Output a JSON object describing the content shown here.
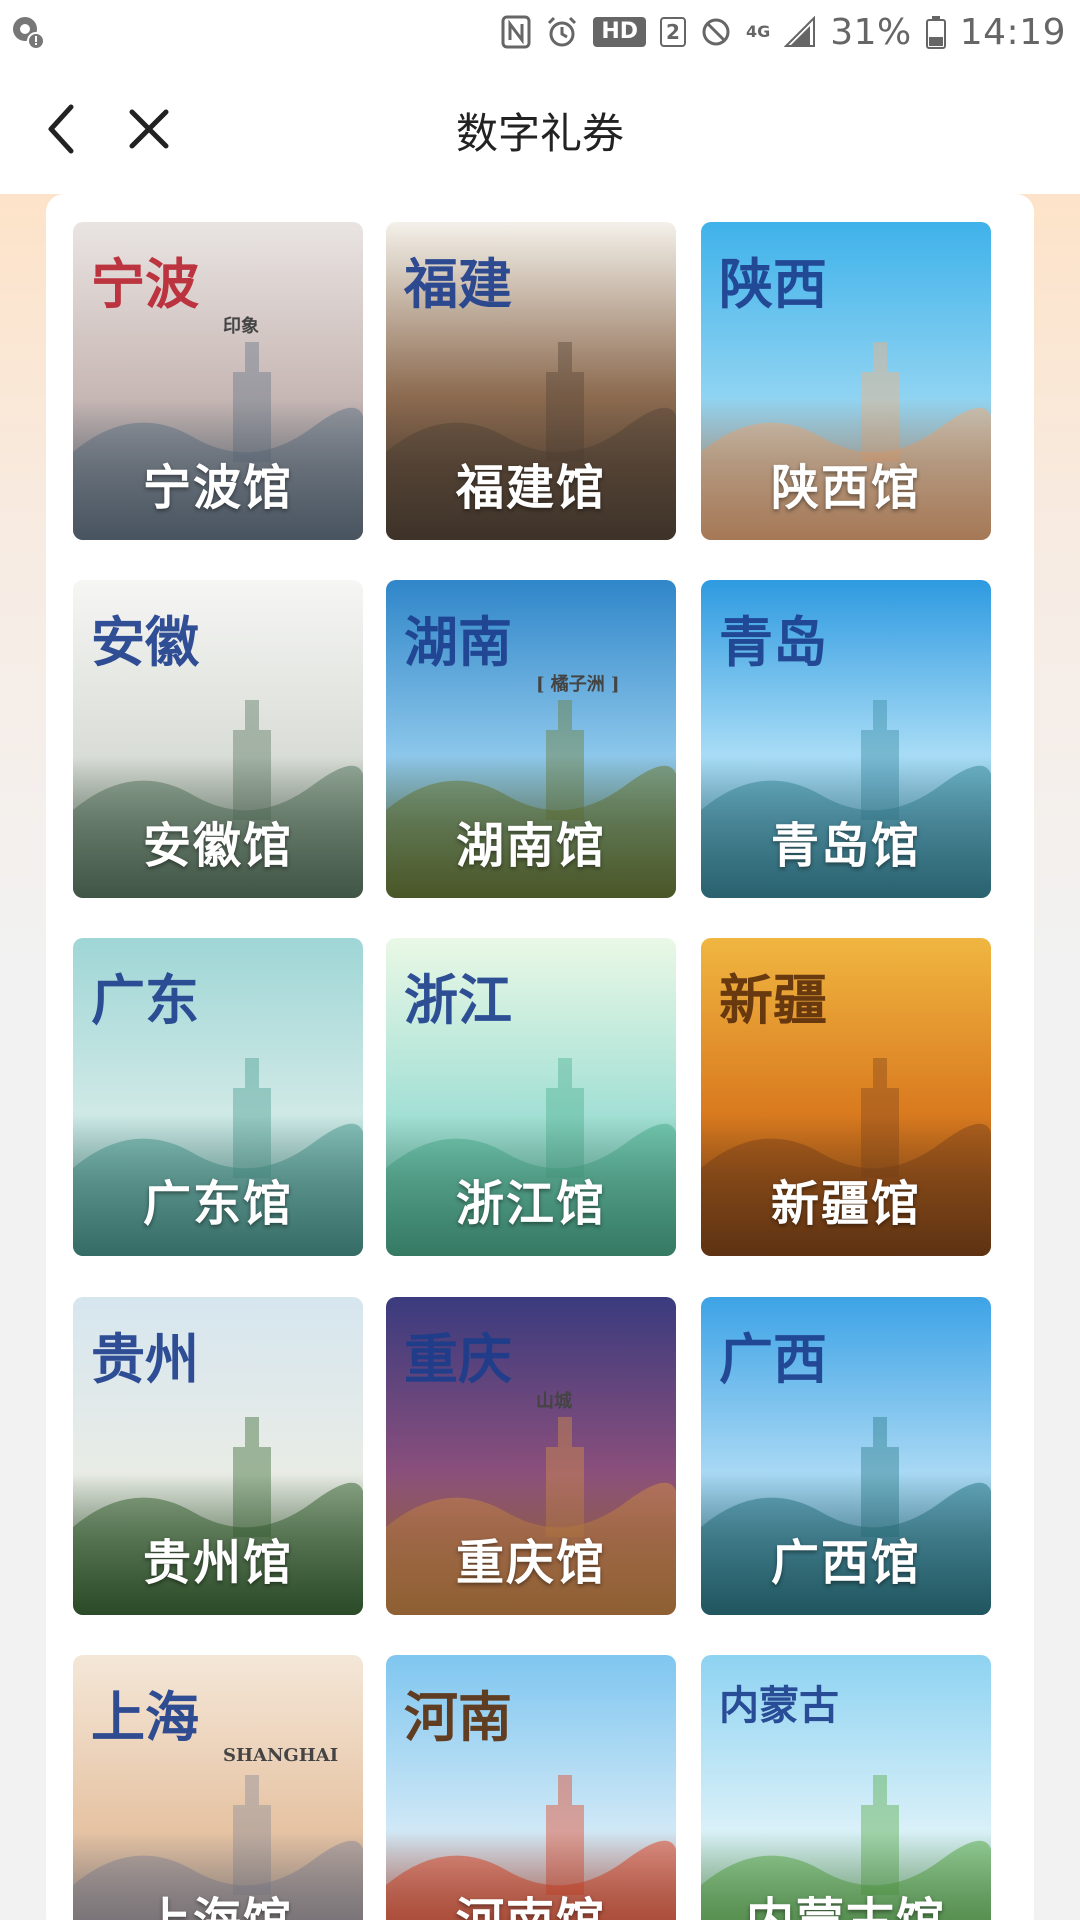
{
  "status_bar": {
    "icons": [
      "notification-icon",
      "nfc-icon",
      "alarm-icon",
      "hd-voice-icon",
      "sim-2-icon",
      "do-not-disturb-icon",
      "4g-icon",
      "signal-icon",
      "battery-icon"
    ],
    "hd_label": "HD",
    "sim_label": "2",
    "network_label": "4G",
    "battery_text": "31%",
    "clock": "14:19"
  },
  "navbar": {
    "title": "数字礼券",
    "back_icon": "chevron-left-icon",
    "close_icon": "close-icon"
  },
  "pavilions": [
    {
      "label": "宁波馆",
      "art_text": "宁波",
      "art_sub": "印象",
      "colors": [
        "#e9e4e2",
        "#c7b7b4",
        "#6a7b8c"
      ]
    },
    {
      "label": "福建馆",
      "art_text": "福建",
      "art_sub": "",
      "colors": [
        "#f4f1ea",
        "#8b6a4f",
        "#5b4a3c"
      ]
    },
    {
      "label": "陕西馆",
      "art_text": "陕西",
      "art_sub": "",
      "colors": [
        "#3fb2ea",
        "#8fd3f2",
        "#f3b17f"
      ]
    },
    {
      "label": "安徽馆",
      "art_text": "安徽",
      "art_sub": "",
      "colors": [
        "#f6f6f4",
        "#d9ddd7",
        "#5f7d66"
      ]
    },
    {
      "label": "湖南馆",
      "art_text": "湖南",
      "art_sub": "[ 橘子洲 ]",
      "colors": [
        "#2f86c9",
        "#8cc6ea",
        "#6d7f3a"
      ]
    },
    {
      "label": "青岛馆",
      "art_text": "青岛",
      "art_sub": "",
      "colors": [
        "#2e9ae0",
        "#a8dcf6",
        "#3e8fa3"
      ]
    },
    {
      "label": "广东馆",
      "art_text": "广东",
      "art_sub": "",
      "colors": [
        "#9fd6d6",
        "#cfe9e6",
        "#4f9f95"
      ]
    },
    {
      "label": "浙江馆",
      "art_text": "浙江",
      "art_sub": "",
      "colors": [
        "#eaf8e6",
        "#a4e0d5",
        "#4fb292"
      ]
    },
    {
      "label": "新疆馆",
      "art_text": "新疆",
      "art_sub": "",
      "colors": [
        "#f0b640",
        "#d97a1f",
        "#8a4b1c"
      ]
    },
    {
      "label": "贵州馆",
      "art_text": "贵州",
      "art_sub": "",
      "colors": [
        "#d6e6ef",
        "#e9ece6",
        "#3f6e3a"
      ]
    },
    {
      "label": "重庆馆",
      "art_text": "重庆",
      "art_sub": "山城",
      "colors": [
        "#3a3b7e",
        "#8a4f7b",
        "#d18d4a"
      ]
    },
    {
      "label": "广西馆",
      "art_text": "广西",
      "art_sub": "",
      "colors": [
        "#3da3e6",
        "#a8d8f4",
        "#2f7e8c"
      ]
    },
    {
      "label": "上海馆",
      "art_text": "上海",
      "art_sub": "SHANGHAI",
      "colors": [
        "#f4e7d8",
        "#e6c3a3",
        "#8f8e9a"
      ]
    },
    {
      "label": "河南馆",
      "art_text": "河南",
      "art_sub": "",
      "colors": [
        "#7fc6f0",
        "#cfe8f6",
        "#e04a2a"
      ]
    },
    {
      "label": "内蒙古馆",
      "art_text": "内蒙古",
      "art_sub": "",
      "colors": [
        "#8ed3f2",
        "#d9f0f8",
        "#5cae4c"
      ]
    }
  ]
}
